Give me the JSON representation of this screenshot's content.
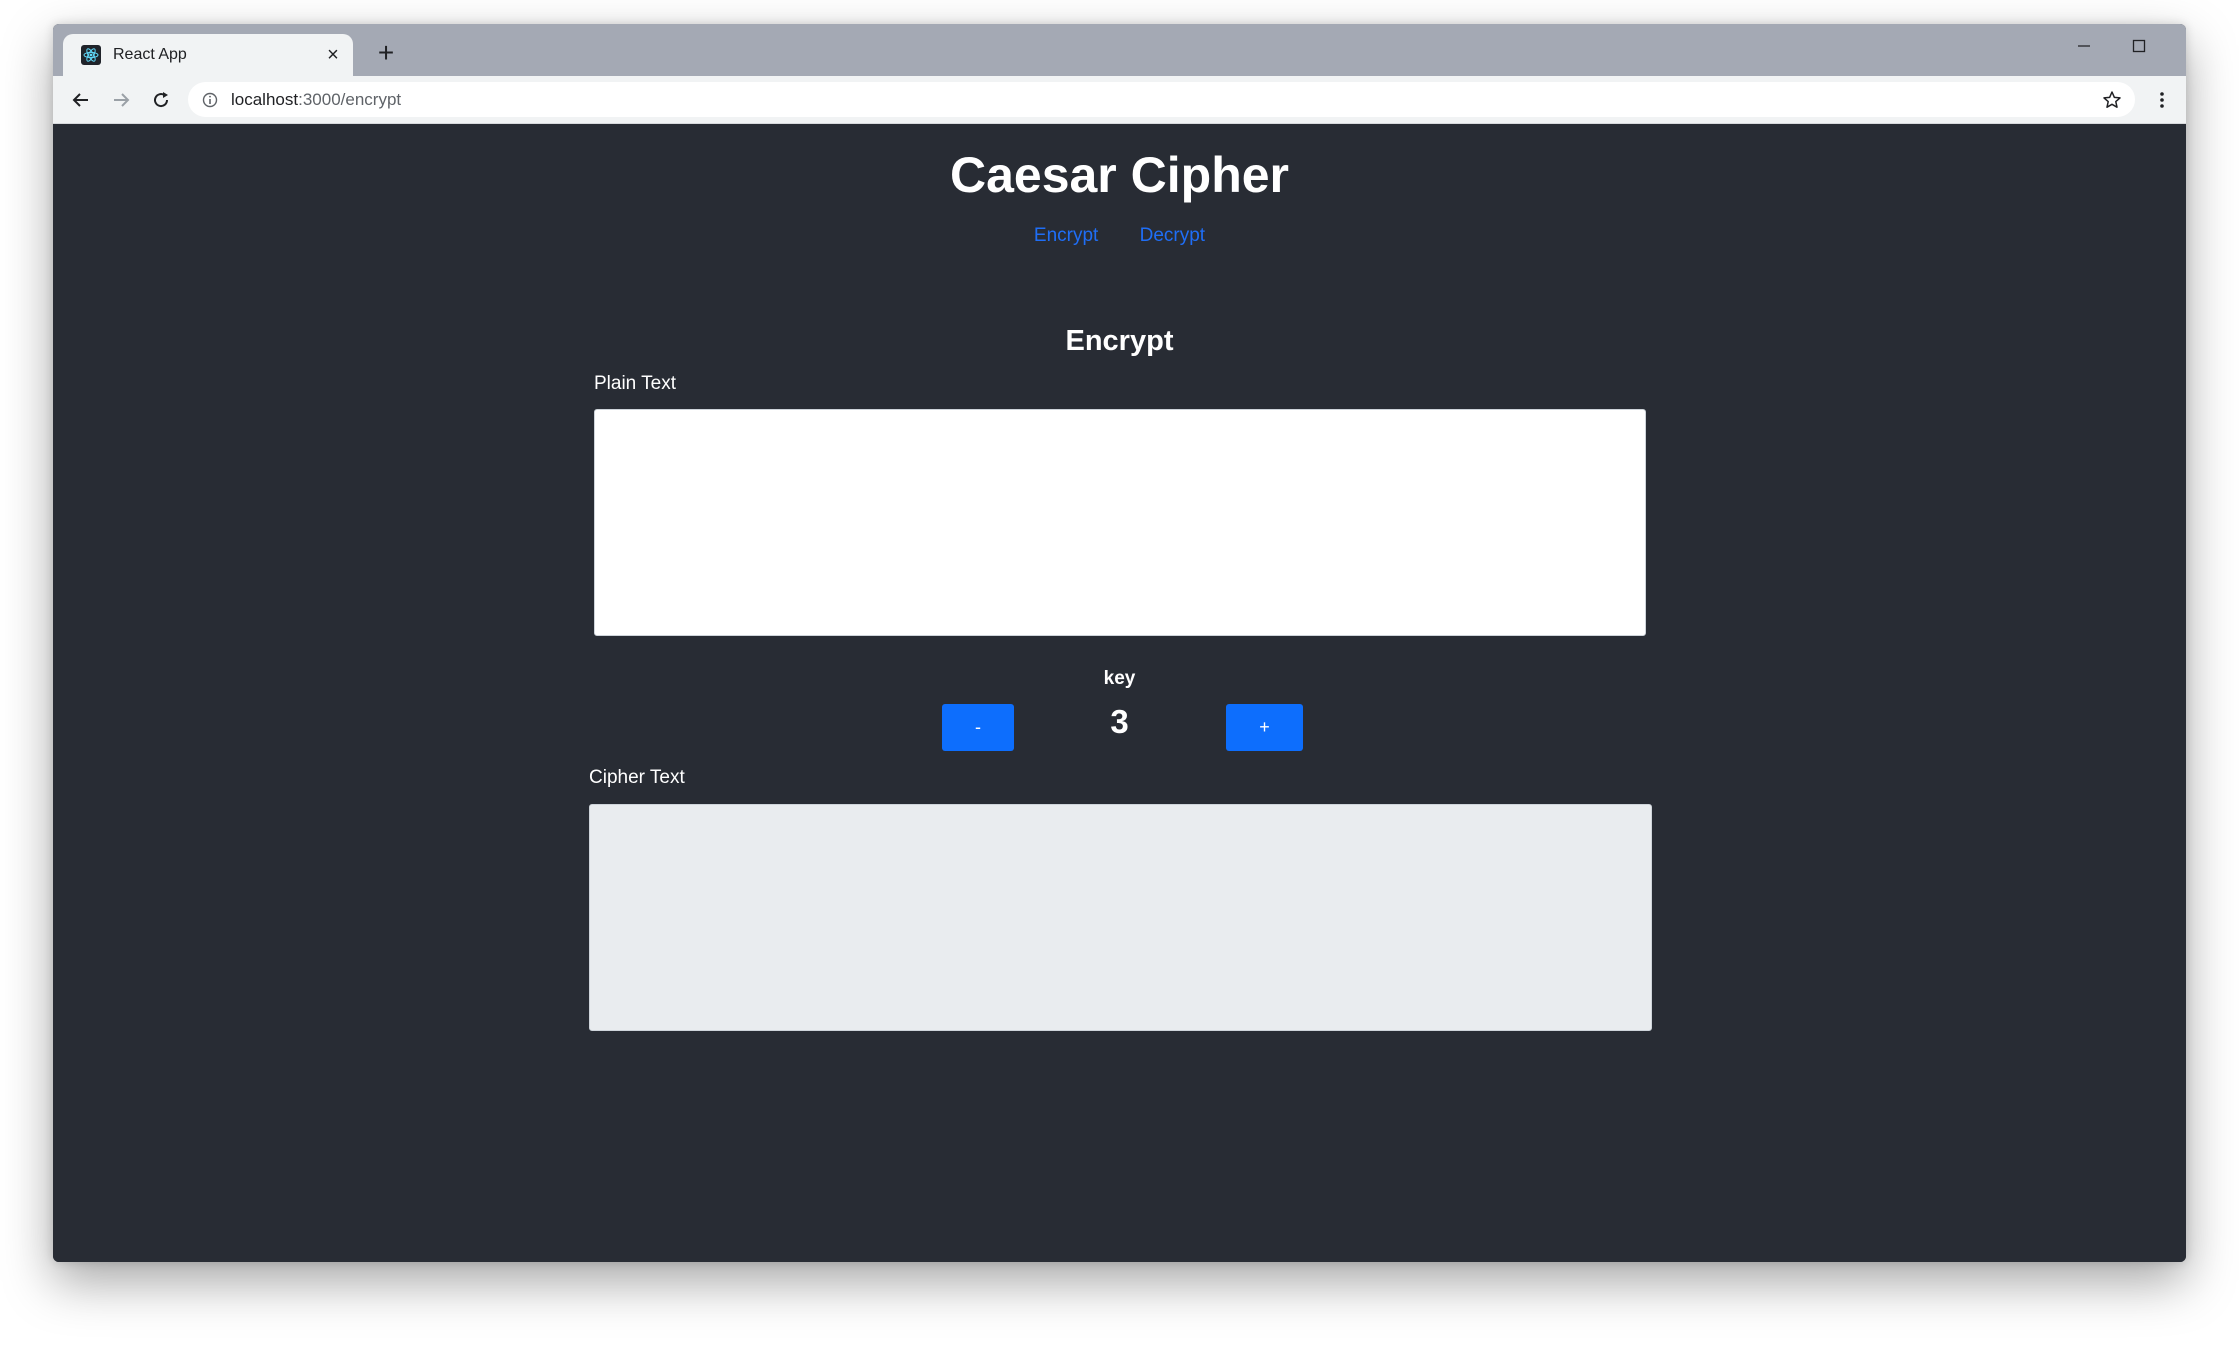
{
  "browser": {
    "tab_title": "React App",
    "tab_close": "×",
    "new_tab": "+",
    "url_host": "localhost",
    "url_path": ":3000/encrypt"
  },
  "app": {
    "title": "Caesar Cipher",
    "nav": [
      {
        "label": "Encrypt"
      },
      {
        "label": "Decrypt"
      }
    ],
    "section_title": "Encrypt",
    "plain_text_label": "Plain Text",
    "plain_text_value": "",
    "key_label": "key",
    "key_value": "3",
    "decrement_label": "-",
    "increment_label": "+",
    "cipher_text_label": "Cipher Text",
    "cipher_text_value": "",
    "colors": {
      "background": "#282c34",
      "link": "#1f6ef6",
      "button": "#0d6efd",
      "cipher_box": "#e9ecef"
    }
  },
  "icons": [
    "react-favicon-icon",
    "close-icon",
    "plus-icon",
    "minimize-icon",
    "maximize-icon",
    "window-close-icon",
    "back-arrow-icon",
    "forward-arrow-icon",
    "reload-icon",
    "info-icon",
    "star-icon",
    "more-vertical-icon"
  ]
}
